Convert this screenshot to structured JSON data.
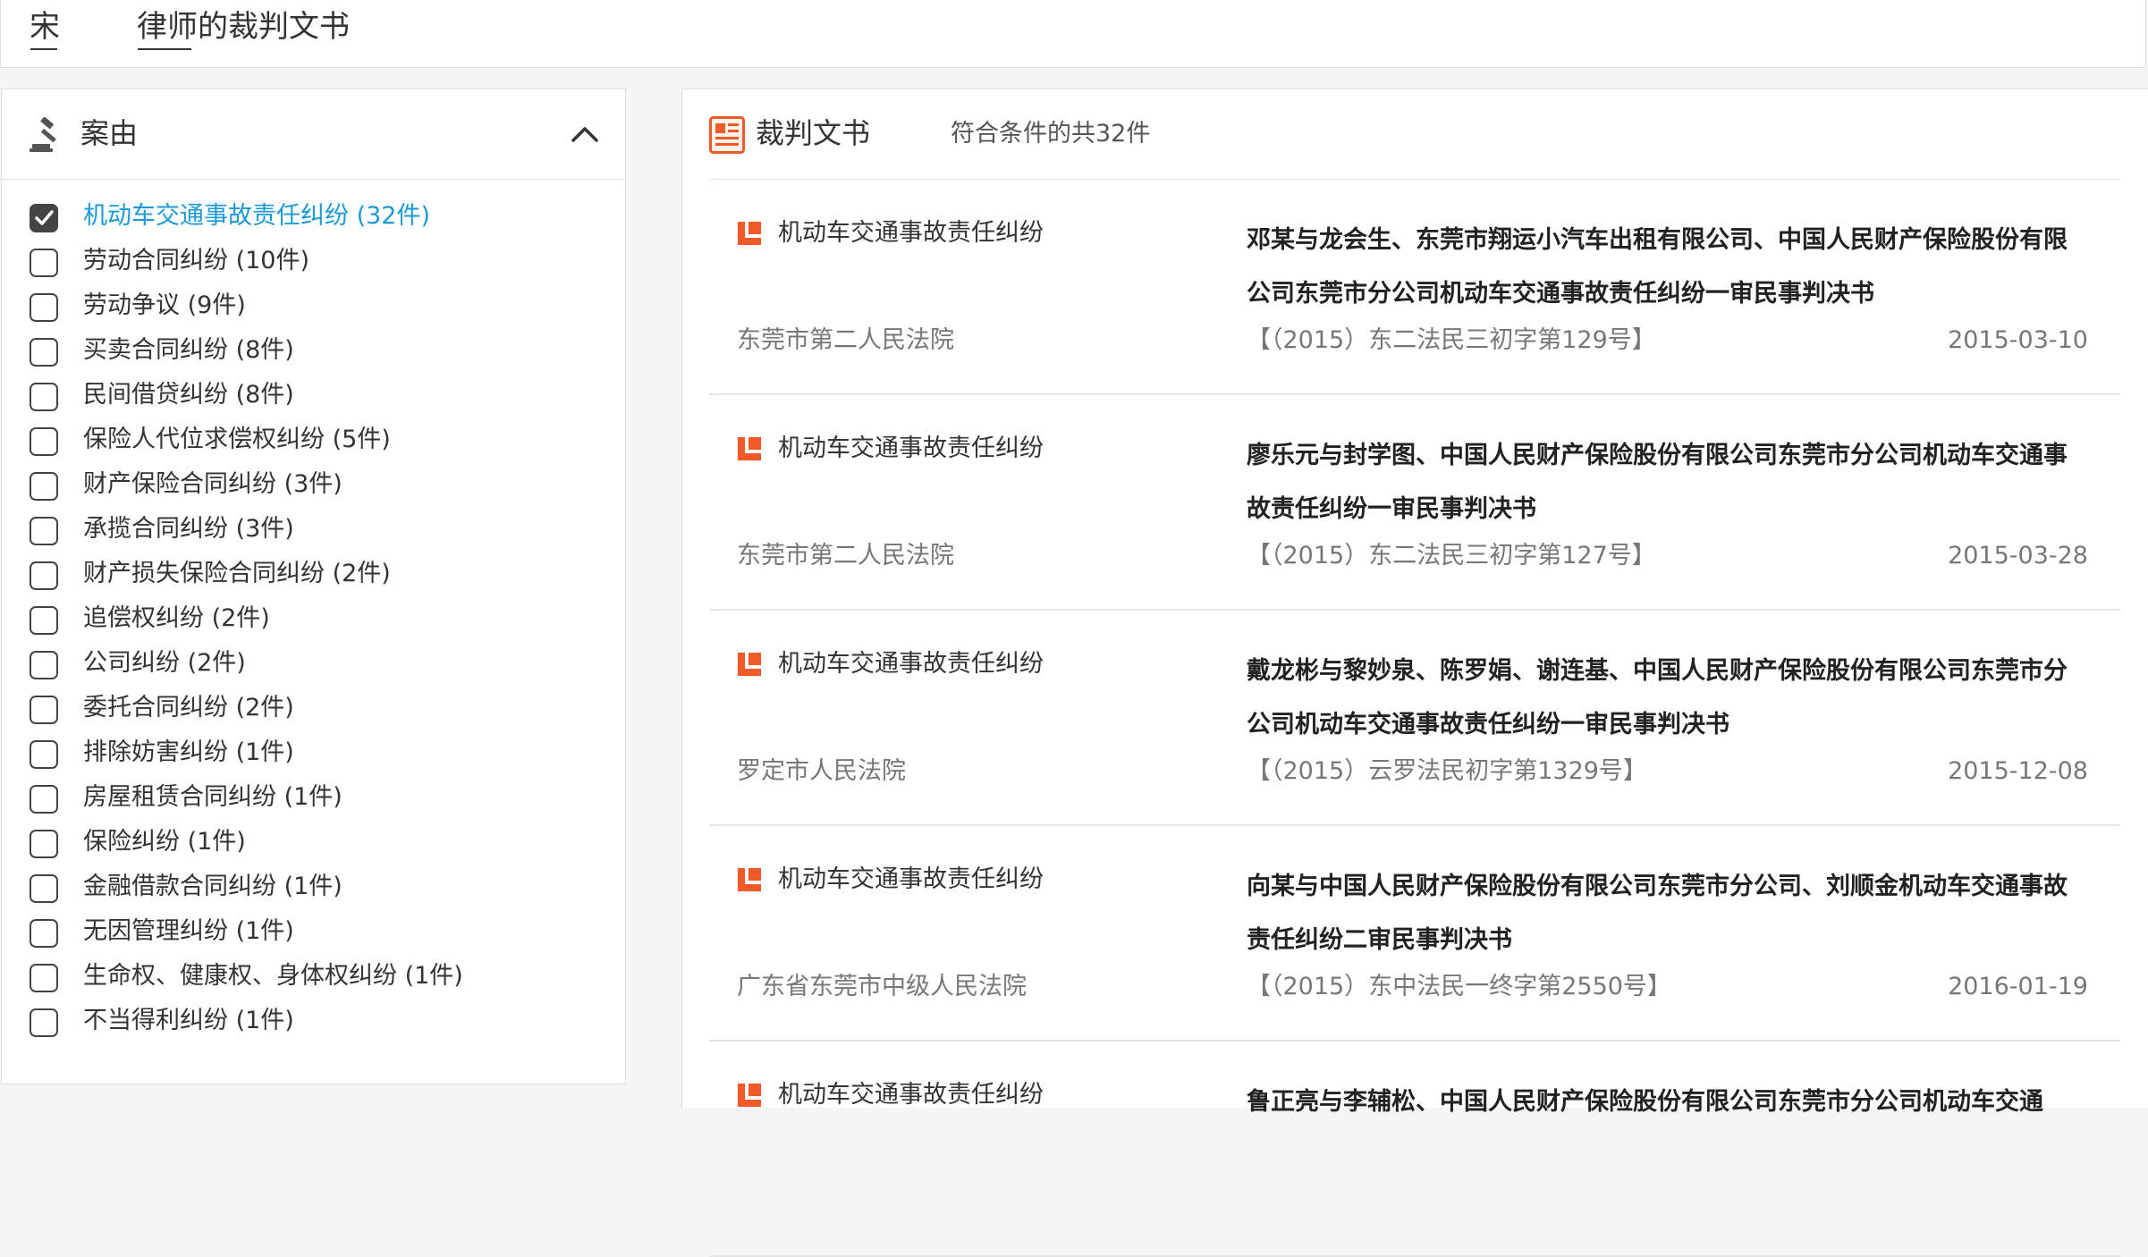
{
  "page": {
    "title_prefix": "宋",
    "title_suffix": "律师的裁判文书"
  },
  "left_panel": {
    "header_title": "案由",
    "header_icon": "gavel-icon",
    "collapse_icon": "chevron-up-icon",
    "causes": [
      {
        "label": "机动车交通事故责任纠纷 (32件)",
        "checked": true
      },
      {
        "label": "劳动合同纠纷 (10件)",
        "checked": false
      },
      {
        "label": "劳动争议 (9件)",
        "checked": false
      },
      {
        "label": "买卖合同纠纷 (8件)",
        "checked": false
      },
      {
        "label": "民间借贷纠纷 (8件)",
        "checked": false
      },
      {
        "label": "保险人代位求偿权纠纷 (5件)",
        "checked": false
      },
      {
        "label": "财产保险合同纠纷 (3件)",
        "checked": false
      },
      {
        "label": "承揽合同纠纷 (3件)",
        "checked": false
      },
      {
        "label": "财产损失保险合同纠纷 (2件)",
        "checked": false
      },
      {
        "label": "追偿权纠纷 (2件)",
        "checked": false
      },
      {
        "label": "公司纠纷 (2件)",
        "checked": false
      },
      {
        "label": "委托合同纠纷 (2件)",
        "checked": false
      },
      {
        "label": "排除妨害纠纷 (1件)",
        "checked": false
      },
      {
        "label": "房屋租赁合同纠纷 (1件)",
        "checked": false
      },
      {
        "label": "保险纠纷 (1件)",
        "checked": false
      },
      {
        "label": "金融借款合同纠纷 (1件)",
        "checked": false
      },
      {
        "label": "无因管理纠纷 (1件)",
        "checked": false
      },
      {
        "label": "生命权、健康权、身体权纠纷 (1件)",
        "checked": false
      },
      {
        "label": "不当得利纠纷 (1件)",
        "checked": false
      }
    ]
  },
  "right_panel": {
    "header_title": "裁判文书",
    "header_icon": "document-icon",
    "result_count": "符合条件的共32件",
    "documents": [
      {
        "type": "机动车交通事故责任纠纷",
        "title": "邓某与龙会生、东莞市翔运小汽车出租有限公司、中国人民财产保险股份有限公司东莞市分公司机动车交通事故责任纠纷一审民事判决书",
        "court": "东莞市第二人民法院",
        "case_number": "【（2015）东二法民三初字第129号】",
        "date": "2015-03-10"
      },
      {
        "type": "机动车交通事故责任纠纷",
        "title": "廖乐元与封学图、中国人民财产保险股份有限公司东莞市分公司机动车交通事故责任纠纷一审民事判决书",
        "court": "东莞市第二人民法院",
        "case_number": "【（2015）东二法民三初字第127号】",
        "date": "2015-03-28"
      },
      {
        "type": "机动车交通事故责任纠纷",
        "title": "戴龙彬与黎妙泉、陈罗娟、谢连基、中国人民财产保险股份有限公司东莞市分公司机动车交通事故责任纠纷一审民事判决书",
        "court": "罗定市人民法院",
        "case_number": "【（2015）云罗法民初字第1329号】",
        "date": "2015-12-08"
      },
      {
        "type": "机动车交通事故责任纠纷",
        "title": "向某与中国人民财产保险股份有限公司东莞市分公司、刘顺金机动车交通事故责任纠纷二审民事判决书",
        "court": "广东省东莞市中级人民法院",
        "case_number": "【（2015）东中法民一终字第2550号】",
        "date": "2016-01-19"
      },
      {
        "type": "机动车交通事故责任纠纷",
        "title": "鲁正亮与李辅松、中国人民财产保险股份有限公司东莞市分公司机动车交通",
        "court": "",
        "case_number": "",
        "date": ""
      }
    ]
  },
  "colors": {
    "accent_blue": "#1a9ad6",
    "icon_orange": "#f05a28",
    "border": "#dedede"
  }
}
